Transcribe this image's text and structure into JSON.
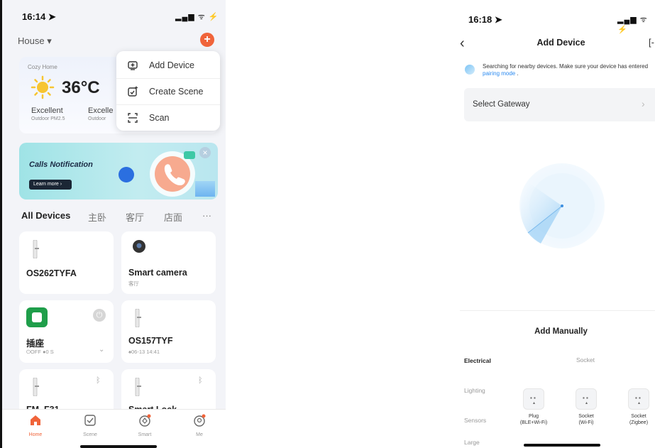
{
  "left": {
    "status_time": "16:14 ➤",
    "status_icons": "▂▄▆ ᯤ ⚡",
    "house_label": "House ▾",
    "weather": {
      "home_name": "Cozy Home",
      "temperature": "36°C",
      "m1_value": "Excellent",
      "m1_label": "Outdoor PM2.5",
      "m2_value": "Excelle",
      "m2_label": "Outdoor"
    },
    "menu": {
      "items": [
        {
          "label": "Add Device",
          "icon": "add-device-icon"
        },
        {
          "label": "Create Scene",
          "icon": "create-scene-icon"
        },
        {
          "label": "Scan",
          "icon": "scan-icon"
        }
      ]
    },
    "banner": {
      "title": "Calls Notification",
      "button": "Learn more ›",
      "close": "×"
    },
    "tabs": [
      "All Devices",
      "主卧",
      "客厅",
      "店面",
      "···"
    ],
    "devices": [
      {
        "name": "OS262TYFA",
        "sub": ""
      },
      {
        "name": "Smart camera",
        "sub": "客厅"
      },
      {
        "name": "插座",
        "sub": "⏻OFF  ●0 S",
        "chev": "⌄"
      },
      {
        "name": "OS157TYF",
        "sub": "♠06-13 14:41"
      },
      {
        "name": "FM_F31",
        "sub": ""
      },
      {
        "name": "Smart Lock",
        "sub": ""
      }
    ],
    "nav": [
      {
        "label": "Home",
        "active": true
      },
      {
        "label": "Scene"
      },
      {
        "label": "Smart"
      },
      {
        "label": "Me"
      }
    ]
  },
  "right": {
    "status_time": "16:18 ➤",
    "status_icons": "▂▄▆ ᯤ ⚡",
    "back": "‹",
    "title": "Add Device",
    "scan_glyph": "[-",
    "tip_text": "Searching for nearby devices. Make sure your device has entered ",
    "tip_link": "pairing mode",
    "tip_end": " .",
    "gateway_label": "Select Gateway",
    "gateway_chev": "›",
    "manual_title": "Add Manually",
    "categories": [
      "Electrical",
      "Lighting",
      "Sensors",
      "Large"
    ],
    "socket_header": "Socket",
    "sockets": [
      {
        "l1": "Plug",
        "l2": "(BLE+Wi-Fi)"
      },
      {
        "l1": "Socket",
        "l2": "(Wi-Fi)"
      },
      {
        "l1": "Socket",
        "l2": "(Zigbee)"
      }
    ]
  },
  "colors": {
    "accent": "#f0643a",
    "link": "#2d8bf0"
  }
}
